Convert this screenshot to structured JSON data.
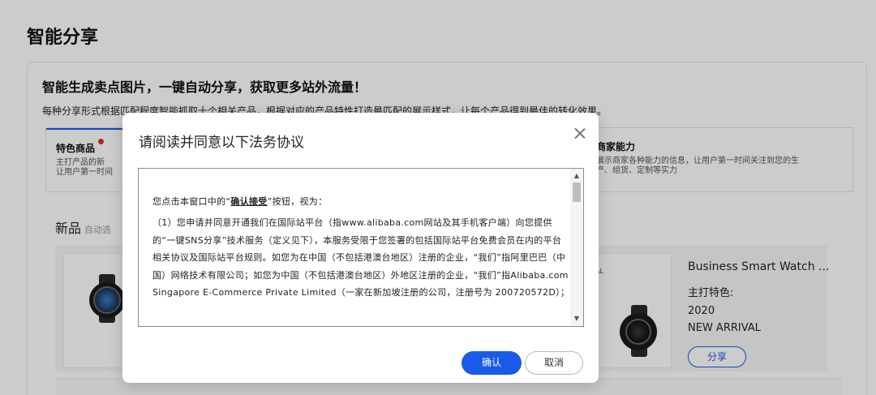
{
  "page": {
    "title": "智能分享",
    "headline": "智能生成卖点图片，一键自动分享，获取更多站外流量！",
    "subline": "每种分享形式根据匹配程度智能抓取十个相关产品，根据对应的产品特性打造最匹配的展示样式，让每个产品得到最佳的转化效果。"
  },
  "tabs": [
    {
      "title": "特色商品",
      "desc_line1": "主打产品的新",
      "desc_line2": "让用户第一时间"
    },
    {
      "title": "商家能力",
      "desc_line1": "展示商家各种能力的信息，让用户第一时间关注到您的生",
      "desc_line2": "产、组货、定制等实力"
    }
  ],
  "section": {
    "title": "新品",
    "hint": "自动选"
  },
  "product": {
    "name": "Business Smart Watch ...",
    "feature_label": "主打特色:",
    "line1": "2020",
    "line2": "NEW ARRIVAL",
    "arrival_badge": "AL",
    "share_label": "分享"
  },
  "modal": {
    "title": "请阅读并同意以下法务协议",
    "close_icon": "close-icon",
    "para1_prefix": "您点击本窗口中的“",
    "para1_bold": "确认接受",
    "para1_suffix": "”按钮，视为：",
    "para2": "（1）您申请并同意开通我们在国际站平台（指www.alibaba.com网站及其手机客户端）向您提供的“一键SNS分享”技术服务（定义见下），本服务受限于您签署的包括国际站平台免费会员在内的平台相关协议及国际站平台规则。如您为在中国（不包括港澳台地区）注册的企业，“我们”指阿里巴巴（中国）网络技术有限公司；如您为中国（不包括港澳台地区）外地区注册的企业，“我们”指Alibaba.com Singapore E-Commerce Private Limited（一家在新加坡注册的公司，注册号为 200720572D）；",
    "confirm_label": "确认",
    "cancel_label": "取消"
  },
  "colors": {
    "accent": "#1a5ae8",
    "badge_red": "#e0301e"
  }
}
